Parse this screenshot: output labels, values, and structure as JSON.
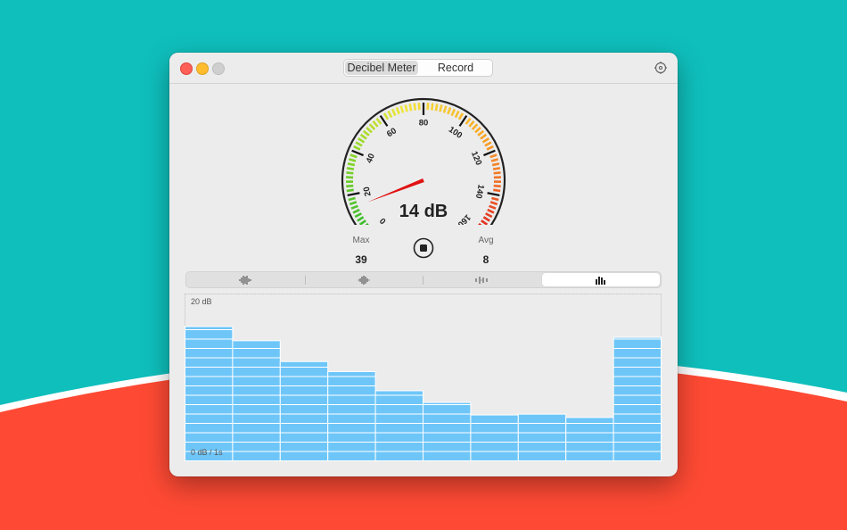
{
  "colors": {
    "bg_teal": "#0fbfbc",
    "bg_red": "#fe4a34",
    "bar_fill": "#6ec6f8",
    "needle": "#e01212"
  },
  "titlebar": {
    "tabs": [
      {
        "label": "Decibel Meter",
        "active": true
      },
      {
        "label": "Record",
        "active": false
      }
    ],
    "settings_icon": "gear-icon"
  },
  "gauge": {
    "ticks": [
      "0",
      "20",
      "40",
      "60",
      "80",
      "100",
      "120",
      "140",
      "160"
    ],
    "min": 0,
    "max": 160,
    "value": 14,
    "readout": "14 dB"
  },
  "stats": {
    "max_label": "Max",
    "max_value": "39",
    "avg_label": "Avg",
    "avg_value": "8",
    "stop_icon": "stop-icon"
  },
  "modes": [
    {
      "icon": "waveform-icon",
      "active": false
    },
    {
      "icon": "waveform-center-icon",
      "active": false
    },
    {
      "icon": "waveform-sparse-icon",
      "active": false
    },
    {
      "icon": "bar-chart-icon",
      "active": true
    }
  ],
  "chart_data": {
    "type": "bar",
    "top_label": "20 dB",
    "bottom_label": "0 dB / 1s",
    "ylim": [
      0,
      20
    ],
    "values": [
      16.1,
      14.4,
      11.9,
      10.7,
      8.4,
      7.0,
      5.5,
      5.6,
      5.2,
      14.8
    ]
  }
}
